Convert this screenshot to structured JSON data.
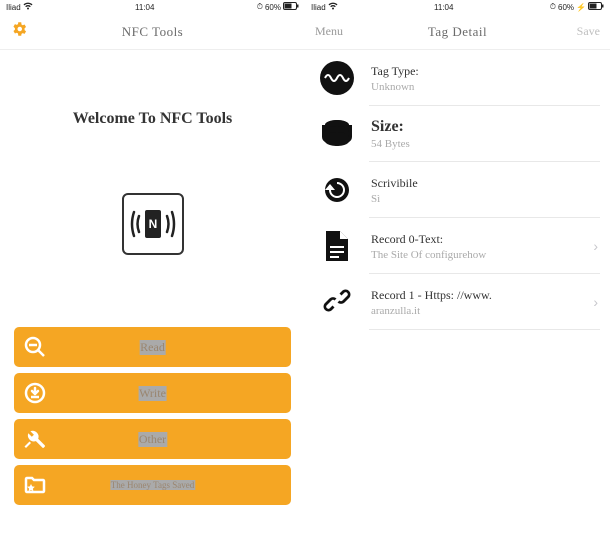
{
  "status": {
    "carrier": "Iliad",
    "time": "11:04",
    "battery": "60%"
  },
  "left": {
    "title": "NFC Tools",
    "welcome": "Welcome To NFC Tools",
    "buttons": {
      "read": "Read",
      "write": "Write",
      "other": "Other",
      "saved": "The Honey Tags Saved"
    }
  },
  "right": {
    "menu": "Menu",
    "title": "Tag Detail",
    "save": "Save",
    "rows": {
      "tagtype": {
        "title": "Tag Type:",
        "sub": "Unknown"
      },
      "size": {
        "title": "Size:",
        "sub": "54 Bytes"
      },
      "writable": {
        "title": "Scrivibile",
        "sub": "Sì"
      },
      "record0": {
        "title": "Record 0-Text:",
        "sub": "The Site Of configurehow"
      },
      "record1": {
        "title": "Record 1 - Https: //www.",
        "sub": "aranzulla.it"
      }
    }
  }
}
